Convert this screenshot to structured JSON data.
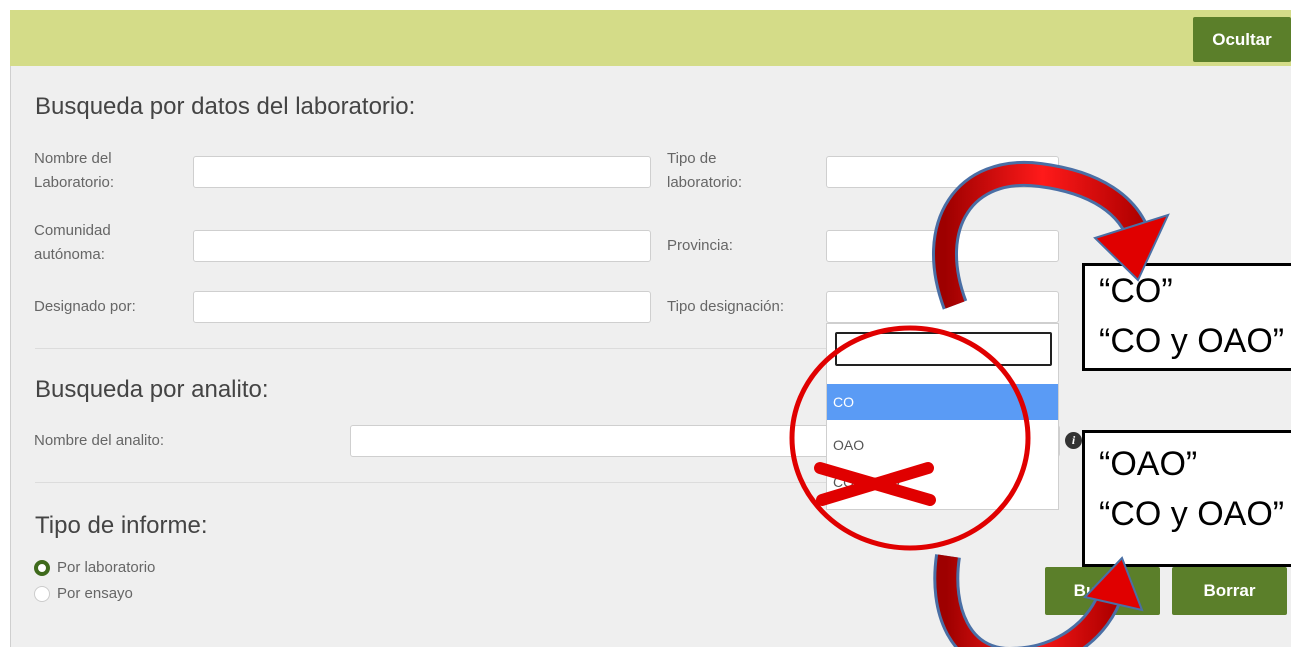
{
  "toolbar": {
    "hide_label": "Ocultar"
  },
  "lab_section": {
    "title": "Busqueda por datos del laboratorio:",
    "fields": {
      "lab_name": {
        "label_line1": "Nombre del",
        "label_line2": "Laboratorio:",
        "value": ""
      },
      "lab_type": {
        "label_line1": "Tipo de",
        "label_line2": "laboratorio:",
        "value": ""
      },
      "community": {
        "label_line1": "Comunidad",
        "label_line2": "autónoma:",
        "value": ""
      },
      "province": {
        "label": "Provincia:",
        "value": ""
      },
      "designated_by": {
        "label": "Designado por:",
        "value": ""
      },
      "designation_type": {
        "label": "Tipo designación:",
        "value": ""
      }
    }
  },
  "designation_dropdown": {
    "search_value": "",
    "options": [
      {
        "label": "CO",
        "selected": true
      },
      {
        "label": "OAO",
        "selected": false
      },
      {
        "label": "CO y OAO",
        "selected": false
      }
    ]
  },
  "analyte_section": {
    "title": "Busqueda por analito:",
    "analyte_name": {
      "label": "Nombre del analito:",
      "value": ""
    }
  },
  "report_section": {
    "title": "Tipo de informe:",
    "options": [
      {
        "label": "Por laboratorio",
        "checked": true
      },
      {
        "label": "Por ensayo",
        "checked": false
      }
    ]
  },
  "actions": {
    "search_label": "Buscar",
    "clear_label": "Borrar"
  },
  "callouts": [
    {
      "line1": "“CO”",
      "line2": "“CO y OAO”"
    },
    {
      "line1": "“OAO”",
      "line2": "“CO y OAO”"
    }
  ],
  "colors": {
    "accent_green": "#5b7f2a",
    "topbar": "#d4dc88",
    "annotation_red": "#e00000",
    "selected_option": "#5a9bf5"
  }
}
